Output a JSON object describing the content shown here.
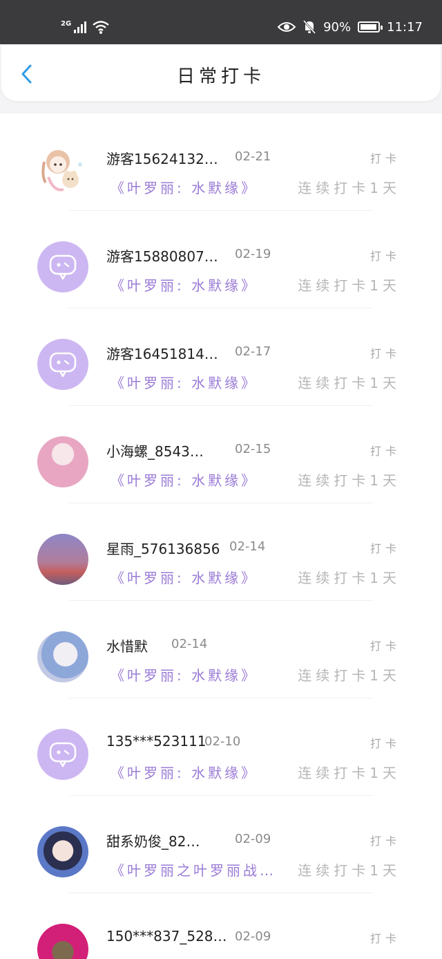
{
  "status_bar": {
    "network": "2G",
    "battery_percent": "90%",
    "time": "11:17"
  },
  "header": {
    "title": "日常打卡"
  },
  "checkins": [
    {
      "user": "游客15624132…",
      "date": "02-21",
      "label": "打卡",
      "book": "《叶罗丽: 水默缘》",
      "streak": "连续打卡1天",
      "avatar": "anime-girl-avatar"
    },
    {
      "user": "游客15880807…",
      "date": "02-19",
      "label": "打卡",
      "book": "《叶罗丽: 水默缘》",
      "streak": "连续打卡1天",
      "avatar": "default-chat-avatar"
    },
    {
      "user": "游客16451814…",
      "date": "02-17",
      "label": "打卡",
      "book": "《叶罗丽: 水默缘》",
      "streak": "连续打卡1天",
      "avatar": "default-chat-avatar"
    },
    {
      "user": "小海螺_8543…",
      "date": "02-15",
      "label": "打卡",
      "book": "《叶罗丽: 水默缘》",
      "streak": "连续打卡1天",
      "avatar": "photo-avatar"
    },
    {
      "user": "星雨_576136856",
      "date": "02-14",
      "label": "打卡",
      "book": "《叶罗丽: 水默缘》",
      "streak": "连续打卡1天",
      "avatar": "photo-avatar"
    },
    {
      "user": "水惜默",
      "date": "02-14",
      "label": "打卡",
      "book": "《叶罗丽: 水默缘》",
      "streak": "连续打卡1天",
      "avatar": "photo-avatar"
    },
    {
      "user": "135***523111",
      "date": "02-10",
      "label": "打卡",
      "book": "《叶罗丽: 水默缘》",
      "streak": "连续打卡1天",
      "avatar": "default-chat-avatar"
    },
    {
      "user": "甜系奶俊_82…",
      "date": "02-09",
      "label": "打卡",
      "book": "《叶罗丽之叶罗丽战…",
      "streak": "连续打卡1天",
      "avatar": "photo-avatar"
    },
    {
      "user": "150***837_528…",
      "date": "02-09",
      "label": "打卡",
      "book": "",
      "streak": "",
      "avatar": "photo-avatar"
    }
  ],
  "colors": {
    "accent_blue": "#2f9be6",
    "book_purple": "#9a7bd6",
    "avatar_purple": "#cdb7f2"
  }
}
